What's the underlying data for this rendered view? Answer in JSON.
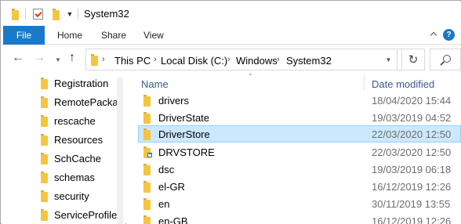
{
  "window": {
    "title": "System32"
  },
  "ribbon": {
    "tabs": [
      {
        "label": "File"
      },
      {
        "label": "Home"
      },
      {
        "label": "Share"
      },
      {
        "label": "View"
      }
    ]
  },
  "address": {
    "crumbs": [
      "This PC",
      "Local Disk (C:)",
      "Windows",
      "System32"
    ]
  },
  "navpane": {
    "items": [
      {
        "label": "Registration"
      },
      {
        "label": "RemotePackag"
      },
      {
        "label": "rescache"
      },
      {
        "label": "Resources"
      },
      {
        "label": "SchCache"
      },
      {
        "label": "schemas"
      },
      {
        "label": "security"
      },
      {
        "label": "ServiceProfile"
      }
    ]
  },
  "filelist": {
    "columns": {
      "name": "Name",
      "date": "Date modified"
    },
    "rows": [
      {
        "name": "drivers",
        "date": "18/04/2020 15:44",
        "selected": false,
        "shortcut": false
      },
      {
        "name": "DriverState",
        "date": "19/03/2019 04:52",
        "selected": false,
        "shortcut": false
      },
      {
        "name": "DriverStore",
        "date": "22/03/2020 12:50",
        "selected": true,
        "shortcut": false
      },
      {
        "name": "DRVSTORE",
        "date": "22/03/2020 12:50",
        "selected": false,
        "shortcut": true
      },
      {
        "name": "dsc",
        "date": "19/03/2019 06:18",
        "selected": false,
        "shortcut": false
      },
      {
        "name": "el-GR",
        "date": "16/12/2019 12:26",
        "selected": false,
        "shortcut": false
      },
      {
        "name": "en",
        "date": "30/11/2019 13:55",
        "selected": false,
        "shortcut": false
      },
      {
        "name": "en-GB",
        "date": "16/12/2019 12:26",
        "selected": false,
        "shortcut": false
      }
    ]
  },
  "colors": {
    "accent": "#1979ca",
    "selection": "#cce8ff",
    "folder": "#f4c542"
  }
}
